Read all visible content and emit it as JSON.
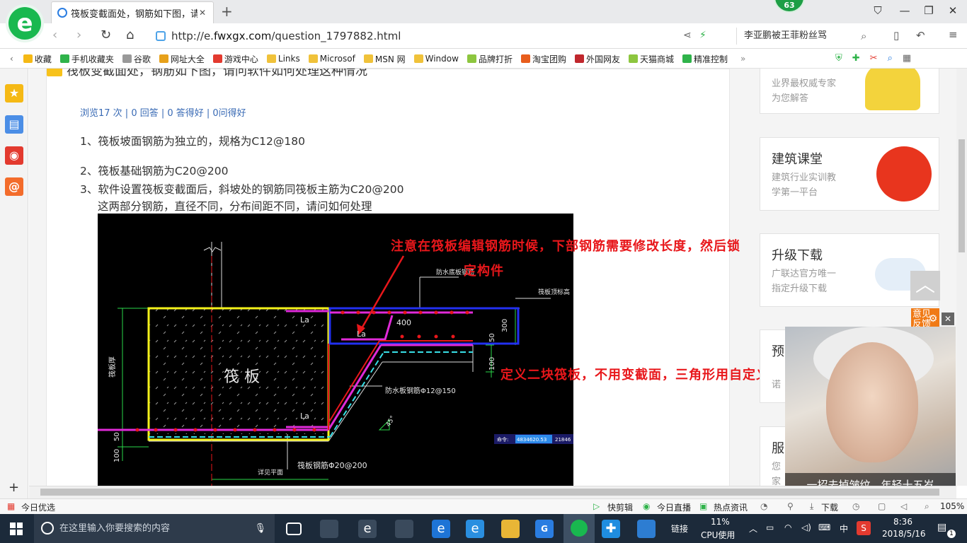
{
  "browser": {
    "tab_title": "筏板变截面处，钢筋如下图，请问",
    "notification_count": "63",
    "url_prefix": "http://e.",
    "url_host": "fwxgx.com",
    "url_path": "/question_1797882.html",
    "search_text": "李亚鹏被王菲粉丝骂"
  },
  "bookmarks": [
    {
      "label": "收藏",
      "color": "#f5b915"
    },
    {
      "label": "手机收藏夹",
      "color": "#2fb34a"
    },
    {
      "label": "谷歌",
      "color": "#999999"
    },
    {
      "label": "网址大全",
      "color": "#e7a11a"
    },
    {
      "label": "游戏中心",
      "color": "#e33a2f"
    },
    {
      "label": "Links",
      "color": "#f0c23a"
    },
    {
      "label": "Microsof",
      "color": "#f0c23a"
    },
    {
      "label": "MSN 网",
      "color": "#f0c23a"
    },
    {
      "label": "Window",
      "color": "#f0c23a"
    },
    {
      "label": "品牌打折",
      "color": "#8dc63f"
    },
    {
      "label": "淘宝团购",
      "color": "#e85d1c"
    },
    {
      "label": "外国网友",
      "color": "#c0272d"
    },
    {
      "label": "天猫商城",
      "color": "#8dc63f"
    },
    {
      "label": "精准控制",
      "color": "#2fb34a"
    }
  ],
  "question": {
    "title": "筏板变截面处，钢筋如下图，请问软件如何处理这种情况",
    "stats": "浏览17 次 | 0 回答 | 0 答得好 | 0问得好",
    "lines": [
      "1、筏板坡面钢筋为独立的，规格为C12@180",
      "2、筏板基础钢筋为C20@200",
      "3、软件设置筏板变截面后，斜坡处的钢筋同筏板主筋为C20@200",
      "这两部分钢筋，直径不同，分布间距不同，请问如何处理"
    ],
    "note1_line1": "注意在筏板编辑钢筋时候，下部钢筋需要修改长度，然后锁",
    "note1_line2": "定构件",
    "note2": "定义二块筏板，不用变截面，三角形用自定义线定义"
  },
  "cad": {
    "raft_label": "筏 板",
    "la": "La",
    "dim_400": "400",
    "dim_300": "300",
    "dim_50": "50",
    "dim_100": "100",
    "thick_label": "筏板厚",
    "waterproof_top": "防水底板钢筋",
    "raft_top": "筏板顶标高",
    "waterproof_slope": "防水板钢筋Φ12@150",
    "raft_bar": "筏板钢筋Φ20@200",
    "plane": "详见平面",
    "angle": "45°",
    "cmd_label": "命令:",
    "coord1": "4834620.53",
    "coord2": "21846"
  },
  "right": [
    {
      "title": "",
      "desc": [
        "业界最权威专家",
        "为您解答"
      ]
    },
    {
      "title": "建筑课堂",
      "desc": [
        "建筑行业实训教",
        "学第一平台"
      ]
    },
    {
      "title": "升级下载",
      "desc": [
        "广联达官方唯一",
        "指定升级下载"
      ]
    },
    {
      "title": "预",
      "desc": [
        "诺"
      ]
    },
    {
      "title": "服",
      "desc": [
        "您",
        "家"
      ]
    }
  ],
  "ad": {
    "tag": "意见反馈",
    "caption": "一招去掉皱纹，年轻十五岁",
    "small": "广告"
  },
  "status": {
    "left": "今日优选",
    "items": [
      "快剪辑",
      "今日直播",
      "热点资讯",
      "下载"
    ],
    "zoom": "105%"
  },
  "taskbar": {
    "search_placeholder": "在这里输入你要搜索的内容",
    "link_label": "链接",
    "cpu_pct": "11%",
    "cpu_label": "CPU使用",
    "ime": "中",
    "time": "8:36",
    "date": "2018/5/16",
    "notif": "1"
  }
}
